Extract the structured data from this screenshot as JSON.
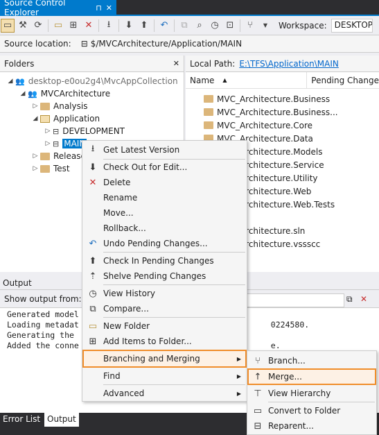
{
  "tab": {
    "title": "Source Control Explorer",
    "pin": "⊓",
    "close": "✕"
  },
  "toolbar": {
    "workspace_label": "Workspace:",
    "workspace_value": "DESKTOP-"
  },
  "source_location": {
    "label": "Source location:",
    "value": "$/MVCArchitecture/Application/MAIN"
  },
  "folders": {
    "title": "Folders",
    "close": "✕",
    "tree": [
      {
        "label": "desktop-e0ou2g4\\MvcAppCollection",
        "type": "collection",
        "arrow": "◢"
      },
      {
        "label": "MVCArchitecture",
        "type": "project",
        "arrow": "◢"
      },
      {
        "label": "Analysis",
        "type": "folder",
        "arrow": "▷"
      },
      {
        "label": "Application",
        "type": "folder-open",
        "arrow": "◢"
      },
      {
        "label": "DEVELOPMENT",
        "type": "branch",
        "arrow": "▷"
      },
      {
        "label": "MAIN",
        "type": "branch",
        "arrow": "▷"
      },
      {
        "label": "Releases",
        "type": "folder",
        "arrow": "▷"
      },
      {
        "label": "Test",
        "type": "folder",
        "arrow": "▷"
      }
    ]
  },
  "local_path": {
    "label": "Local Path:",
    "value": "E:\\TFS\\Application\\MAIN"
  },
  "columns": {
    "name": "Name",
    "pending": "Pending Change"
  },
  "files": [
    {
      "name": "MVC_Architecture.Business"
    },
    {
      "name": "MVC_Architecture.Business..."
    },
    {
      "name": "MVC_Architecture.Core"
    },
    {
      "name": "MVC_Architecture.Data"
    },
    {
      "name": "MVC_Architecture.Models"
    },
    {
      "name": "MVC_Architecture.Service"
    },
    {
      "name": "MVC_Architecture.Utility"
    },
    {
      "name": "MVC_Architecture.Web"
    },
    {
      "name": "MVC_Architecture.Web.Tests"
    },
    {
      "name": "MVC_Architecture.sln"
    },
    {
      "name": "MVC_Architecture.vssscc"
    }
  ],
  "output": {
    "title": "Output",
    "show_from": "Show output from:",
    "lines": [
      "Generated model",
      "Loading metadat                                        0224580.",
      "Generating the ",
      "Added the conne                                        e."
    ]
  },
  "bottom_tabs": [
    "Error List",
    "Output"
  ],
  "context_menu": [
    {
      "label": "Get Latest Version",
      "icon": "get-latest-icon",
      "glyph": "⭳"
    },
    {
      "label": "Check Out for Edit...",
      "icon": "check-out-icon",
      "glyph": "⬇"
    },
    {
      "label": "Delete",
      "icon": "delete-icon",
      "glyph": "✕",
      "color": "#c72d2d"
    },
    {
      "label": "Rename",
      "icon": "",
      "glyph": ""
    },
    {
      "label": "Move...",
      "icon": "",
      "glyph": ""
    },
    {
      "label": "Rollback...",
      "icon": "",
      "glyph": ""
    },
    {
      "label": "Undo Pending Changes...",
      "icon": "undo-icon",
      "glyph": "↶",
      "color": "#1e6fbf"
    },
    {
      "label": "Check In Pending Changes",
      "icon": "check-in-icon",
      "glyph": "⬆"
    },
    {
      "label": "Shelve Pending Changes",
      "icon": "shelve-icon",
      "glyph": "⇡"
    },
    {
      "label": "View History",
      "icon": "history-icon",
      "glyph": "◷"
    },
    {
      "label": "Compare...",
      "icon": "compare-icon",
      "glyph": "⧉"
    },
    {
      "label": "New Folder",
      "icon": "new-folder-icon",
      "glyph": "▭"
    },
    {
      "label": "Add Items to Folder...",
      "icon": "add-items-icon",
      "glyph": "⊞"
    },
    {
      "label": "Branching and Merging",
      "icon": "",
      "glyph": "",
      "submenu": true
    },
    {
      "label": "Find",
      "icon": "",
      "glyph": "",
      "submenu": true
    },
    {
      "label": "Advanced",
      "icon": "",
      "glyph": "",
      "submenu": true
    }
  ],
  "submenu": [
    {
      "label": "Branch...",
      "icon": "branch-icon",
      "glyph": "⑂"
    },
    {
      "label": "Merge...",
      "icon": "merge-icon",
      "glyph": "↑"
    },
    {
      "label": "View Hierarchy",
      "icon": "hierarchy-icon",
      "glyph": "⊤"
    },
    {
      "label": "Convert to Folder",
      "icon": "convert-folder-icon",
      "glyph": "▭"
    },
    {
      "label": "Reparent...",
      "icon": "reparent-icon",
      "glyph": "⊟"
    }
  ],
  "colors": {
    "accent": "#007acc",
    "highlight": "#f08d2a",
    "link": "#0066cc"
  }
}
